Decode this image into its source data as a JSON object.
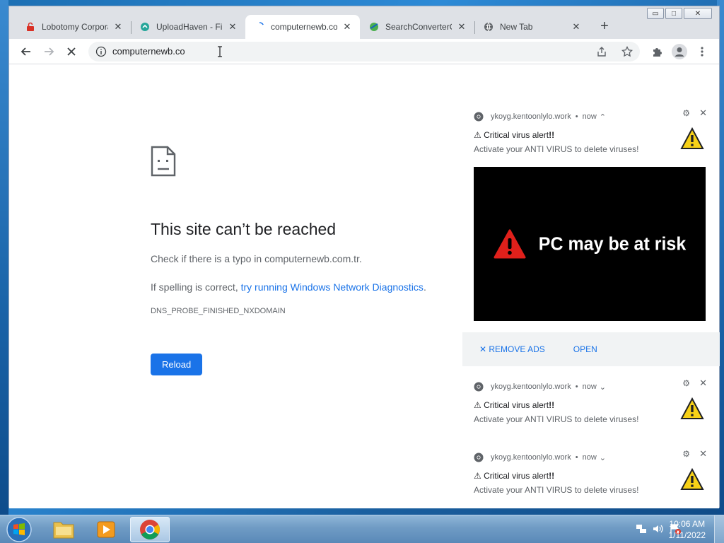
{
  "window": {
    "controls": {
      "minimize": "▭",
      "restore": "□",
      "close": "✕"
    }
  },
  "tabs": [
    {
      "title": "Lobotomy Corpora",
      "icon": "red-lock-icon"
    },
    {
      "title": "UploadHaven - File",
      "icon": "uploadhaven-icon"
    },
    {
      "title": "computernewb.co",
      "icon": "loading-icon",
      "active": true
    },
    {
      "title": "SearchConverterO",
      "icon": "searchconverter-icon"
    },
    {
      "title": "New Tab",
      "icon": "globe-icon"
    }
  ],
  "tab_close_glyph": "✕",
  "new_tab_glyph": "+",
  "toolbar": {
    "url": "computernewb.co"
  },
  "error_page": {
    "title": "This site can’t be reached",
    "typo_line": "Check if there is a typo in computernewb.com.tr.",
    "spelling_prefix": "If spelling is correct, ",
    "diagnostics_link": "try running Windows Network Diagnostics",
    "spelling_suffix": ".",
    "error_code": "DNS_PROBE_FINISHED_NXDOMAIN",
    "reload_label": "Reload"
  },
  "notifications": [
    {
      "source": "ykoyg.kentoonlylo.work",
      "dot": "•",
      "time": "now",
      "chevron": "⌃",
      "title_prefix": "⚠ Critical virus alert",
      "title_bang": "!!",
      "body": "Activate your ANTI VIRUS to delete viruses!",
      "image_text": "PC may be at risk",
      "actions": {
        "remove_ads": "✕ REMOVE ADS",
        "open": "OPEN"
      }
    },
    {
      "source": "ykoyg.kentoonlylo.work",
      "dot": "•",
      "time": "now",
      "chevron": "⌄",
      "title_prefix": "⚠ Critical virus alert",
      "title_bang": "!!",
      "body": "Activate your ANTI VIRUS to delete viruses!"
    },
    {
      "source": "ykoyg.kentoonlylo.work",
      "dot": "•",
      "time": "now",
      "chevron": "⌄",
      "title_prefix": "⚠ Critical virus alert",
      "title_bang": "!!",
      "body": "Activate your ANTI VIRUS to delete viruses!"
    }
  ],
  "notif_controls": {
    "gear": "⚙",
    "close": "✕"
  },
  "taskbar": {
    "clock_time": "10:06 AM",
    "clock_date": "1/11/2022"
  },
  "colors": {
    "accent": "#1a73e8",
    "warning_yellow": "#f7d117",
    "danger_red": "#e0201b"
  }
}
